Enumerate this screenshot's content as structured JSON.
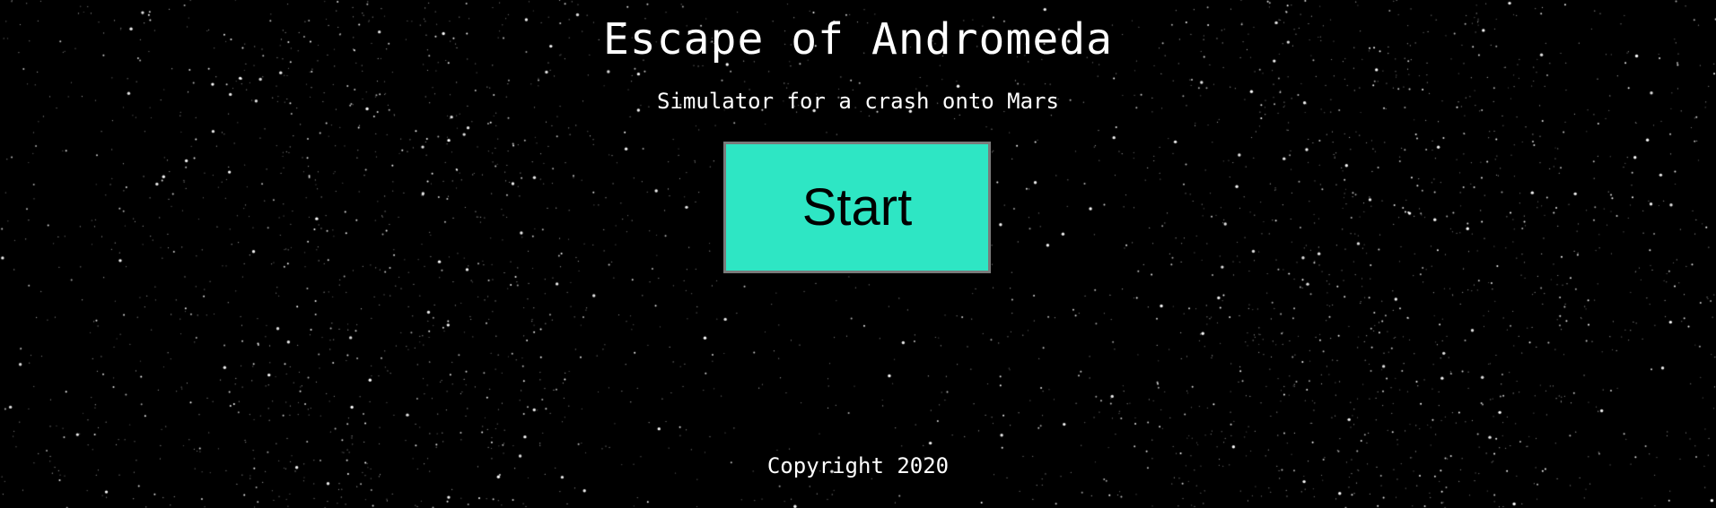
{
  "page": {
    "title": "Escape of Andromeda",
    "subtitle": "Simulator for a crash onto Mars",
    "start_label": "Start",
    "footer": "Copyright 2020"
  },
  "colors": {
    "background": "#000000",
    "text": "#ffffff",
    "button_fill": "#2ee6c4",
    "button_border": "#7a7a7a",
    "button_text": "#000000"
  }
}
